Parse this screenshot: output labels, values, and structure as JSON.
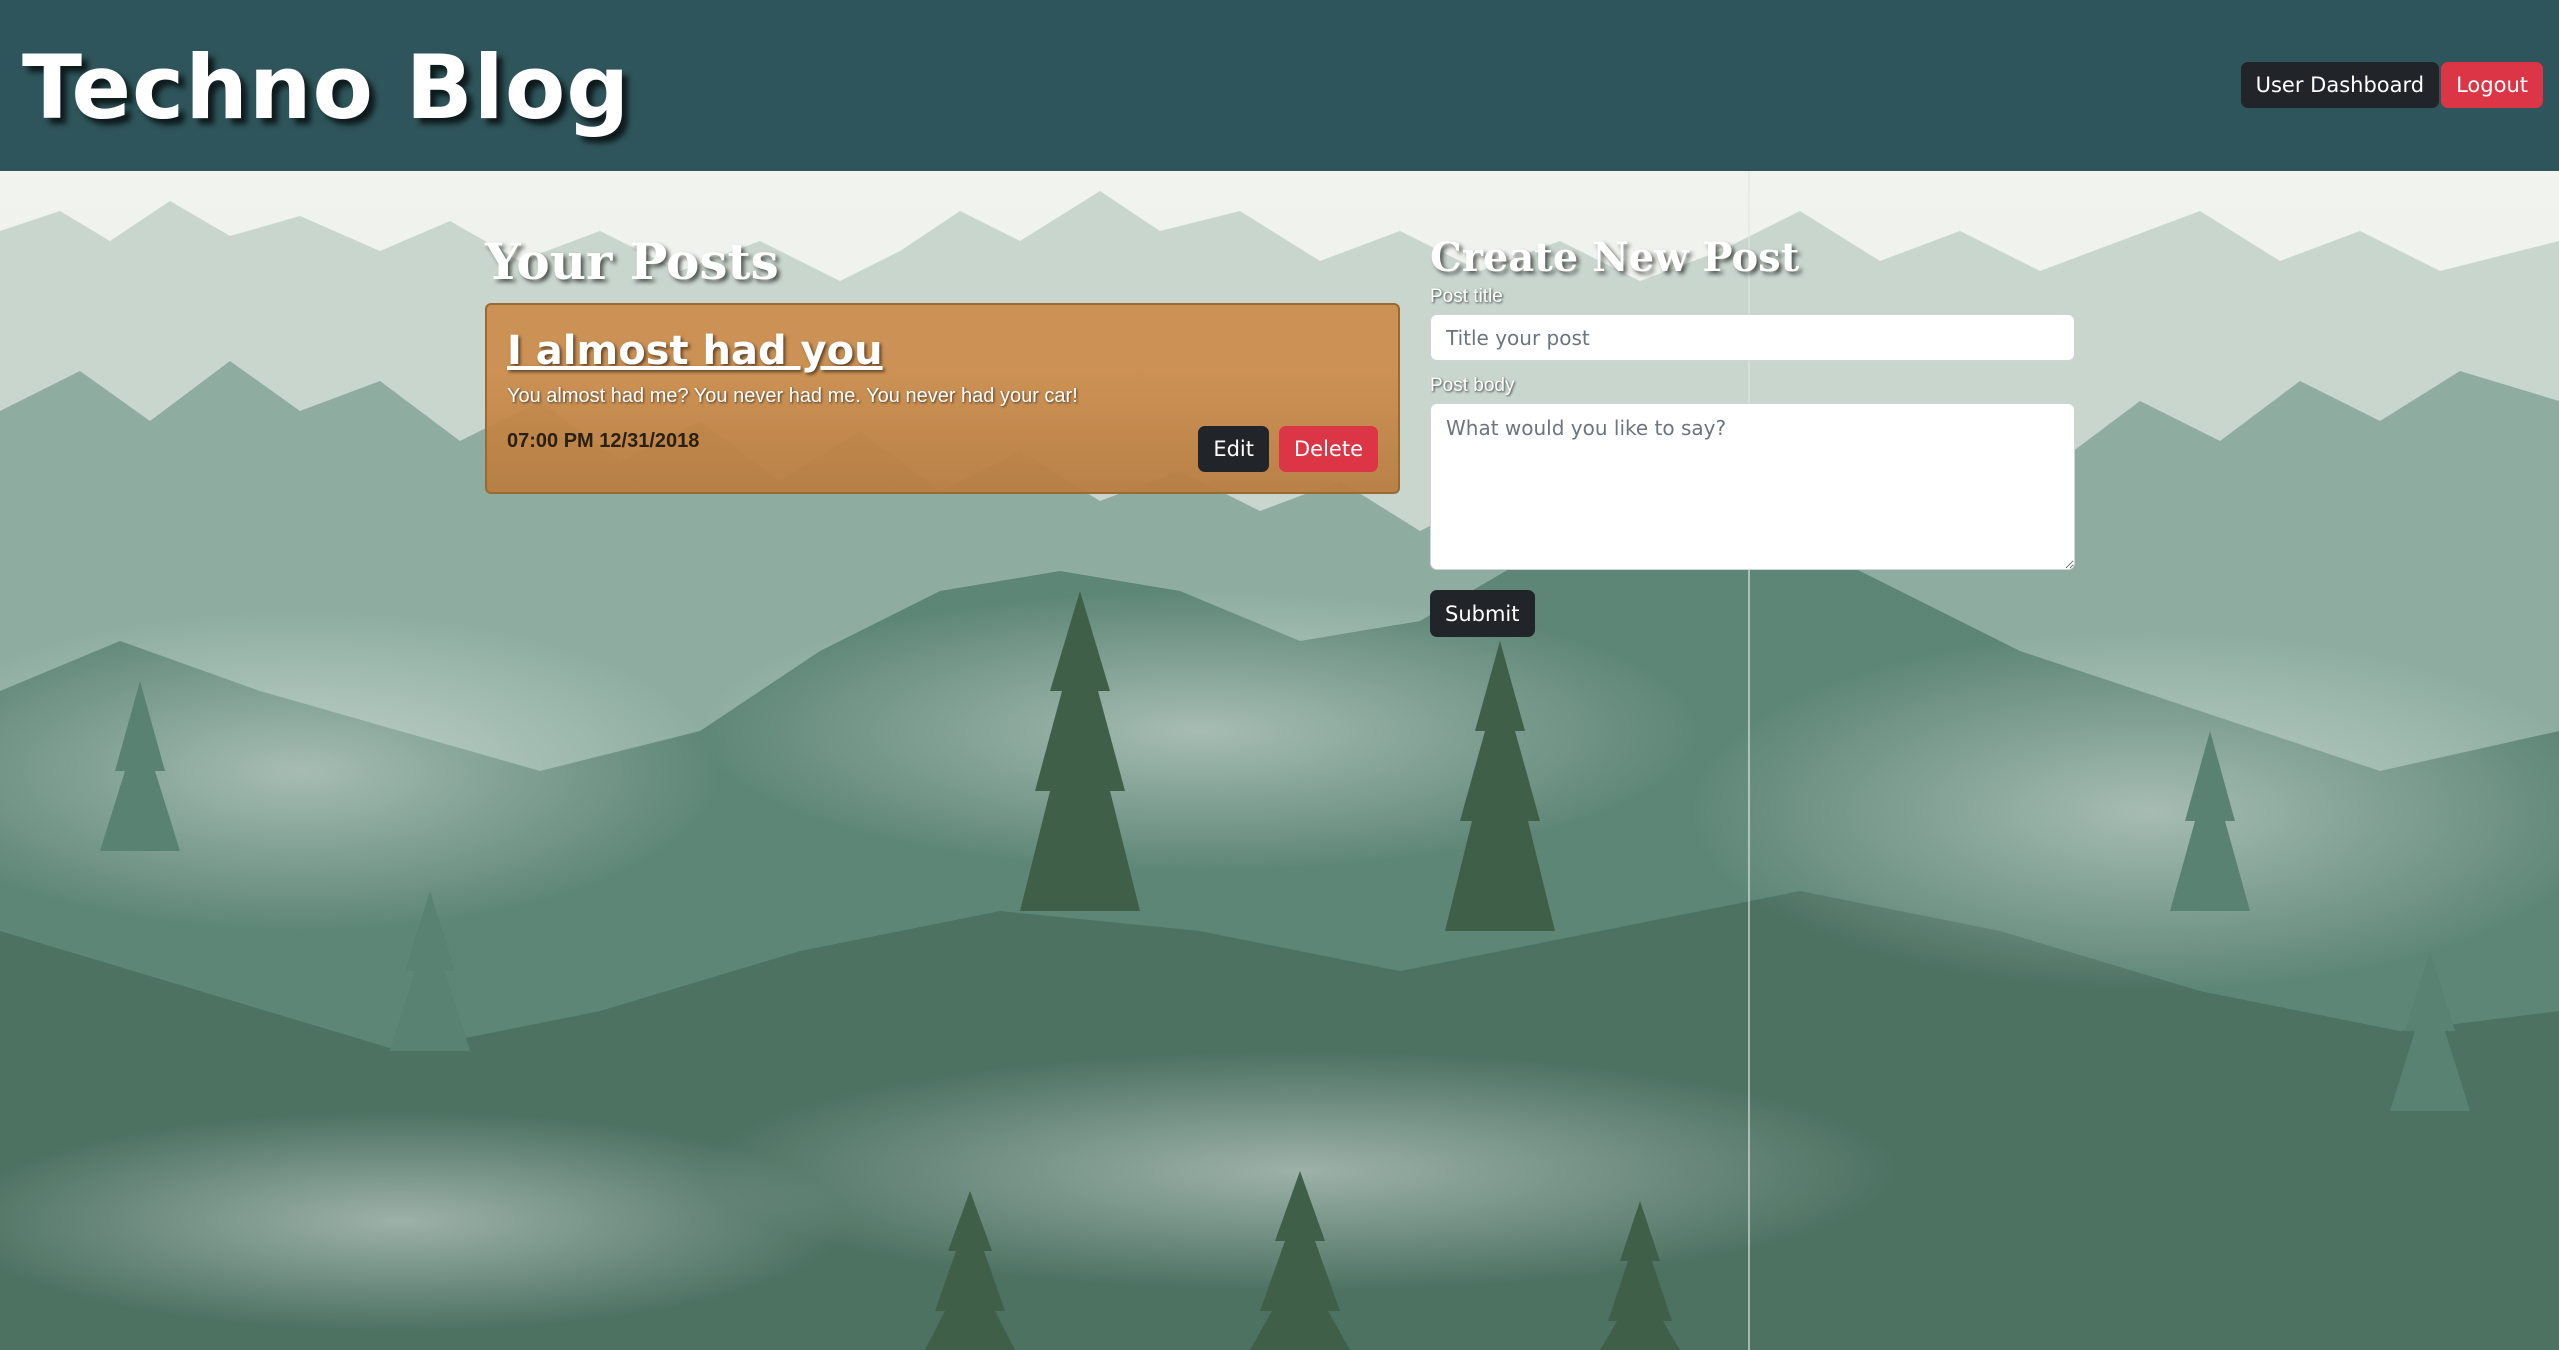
{
  "header": {
    "site_title": "Techno Blog",
    "nav": {
      "dashboard_label": "User Dashboard",
      "logout_label": "Logout"
    }
  },
  "posts_section": {
    "title": "Your Posts",
    "posts": [
      {
        "title": "I almost had you",
        "body": "You almost had me? You never had me. You never had your car!",
        "date": "07:00 PM 12/31/2018",
        "edit_label": "Edit",
        "delete_label": "Delete"
      }
    ]
  },
  "create_section": {
    "title": "Create New Post",
    "title_label": "Post title",
    "title_placeholder": "Title your post",
    "body_label": "Post body",
    "body_placeholder": "What would you like to say?",
    "submit_label": "Submit"
  },
  "colors": {
    "header_bg": "#2e555b",
    "card_bg": "#cc8c4a",
    "button_dark": "#212529",
    "button_danger": "#dc3545"
  }
}
